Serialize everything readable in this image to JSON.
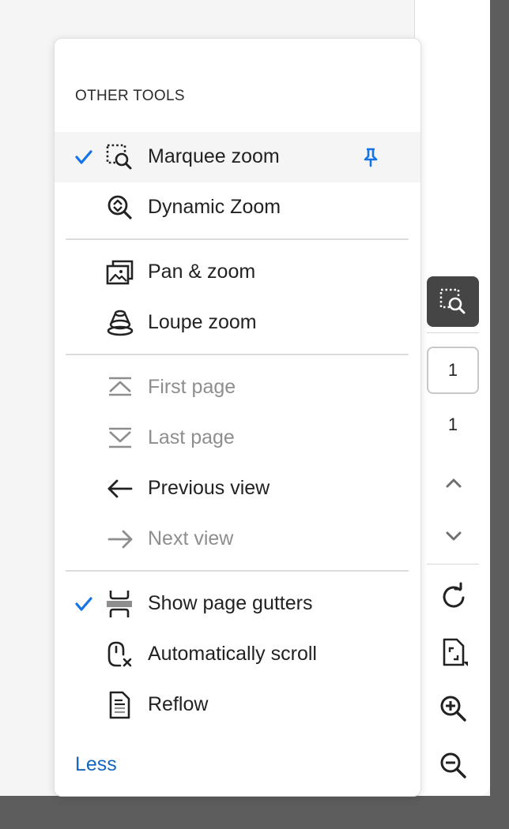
{
  "menu": {
    "heading": "OTHER TOOLS",
    "items": [
      {
        "label": "Marquee zoom",
        "icon": "marquee-zoom-icon",
        "checked": true,
        "pinned": true,
        "disabled": false
      },
      {
        "label": "Dynamic Zoom",
        "icon": "dynamic-zoom-icon",
        "checked": false,
        "disabled": false
      },
      {
        "label": "Pan & zoom",
        "icon": "pan-zoom-icon",
        "checked": false,
        "disabled": false
      },
      {
        "label": "Loupe zoom",
        "icon": "loupe-zoom-icon",
        "checked": false,
        "disabled": false
      },
      {
        "label": "First page",
        "icon": "first-page-icon",
        "checked": false,
        "disabled": true
      },
      {
        "label": "Last page",
        "icon": "last-page-icon",
        "checked": false,
        "disabled": true
      },
      {
        "label": "Previous view",
        "icon": "arrow-left-icon",
        "checked": false,
        "disabled": false
      },
      {
        "label": "Next view",
        "icon": "arrow-right-icon",
        "checked": false,
        "disabled": true
      },
      {
        "label": "Show page gutters",
        "icon": "page-gutters-icon",
        "checked": true,
        "disabled": false
      },
      {
        "label": "Automatically scroll",
        "icon": "auto-scroll-icon",
        "checked": false,
        "disabled": false
      },
      {
        "label": "Reflow",
        "icon": "reflow-icon",
        "checked": false,
        "disabled": false
      }
    ],
    "less_label": "Less"
  },
  "toolbar": {
    "active_tool_icon": "marquee-zoom-icon",
    "page_input_value": "1",
    "page_total": "1",
    "buttons": [
      "chevron-up-icon",
      "chevron-down-icon",
      "rotate-icon",
      "fit-page-icon",
      "zoom-in-icon",
      "zoom-out-icon"
    ]
  },
  "colors": {
    "accent": "#1473e6",
    "link": "#1565c0",
    "disabled_text": "#8e8e8e",
    "active_tool_bg": "#454545"
  }
}
